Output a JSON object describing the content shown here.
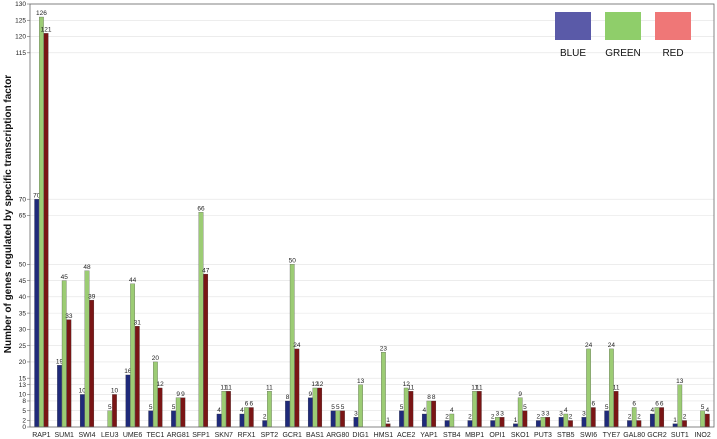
{
  "chart_data": {
    "type": "bar",
    "ylabel": "Number of genes regulated by specific transcription factor",
    "xlabel": "",
    "ylim": [
      0,
      130
    ],
    "yticks": [
      0,
      2,
      5,
      8,
      10,
      13,
      15,
      20,
      25,
      30,
      35,
      40,
      45,
      50,
      65,
      70,
      115,
      120,
      125,
      130
    ],
    "ytick_labels": [
      "0",
      "2",
      "5",
      "8",
      "10",
      "13",
      "15",
      "20",
      "25",
      "30",
      "35",
      "40",
      "45",
      "50",
      "65",
      "70",
      "115",
      "120",
      "125",
      "130"
    ],
    "grid": true,
    "legend_position": "top-right",
    "categories": [
      "RAP1",
      "SUM1",
      "SWI4",
      "LEU3",
      "UME6",
      "TEC1",
      "ARG81",
      "SFP1",
      "SKN7",
      "RFX1",
      "SPT2",
      "GCR1",
      "BAS1",
      "ARG80",
      "DIG1",
      "HMS1",
      "ACE2",
      "YAP1",
      "STB4",
      "MBP1",
      "OPI1",
      "SKO1",
      "PUT3",
      "STB5",
      "SWI6",
      "TYE7",
      "GAL80",
      "GCR2",
      "SUT1",
      "INO2"
    ],
    "series": [
      {
        "name": "BLUE",
        "color": "#1f2a7a",
        "values": [
          70,
          19,
          10,
          null,
          16,
          5,
          5,
          null,
          4,
          4,
          2,
          8,
          9,
          5,
          3,
          null,
          5,
          4,
          2,
          2,
          2,
          1,
          2,
          3,
          3,
          5,
          2,
          4,
          1,
          null
        ]
      },
      {
        "name": "GREEN",
        "color": "#9ccc74",
        "values": [
          126,
          45,
          48,
          5,
          44,
          20,
          9,
          66,
          11,
          6,
          11,
          50,
          12,
          5,
          13,
          23,
          12,
          8,
          4,
          11,
          3,
          9,
          3,
          4,
          24,
          24,
          6,
          6,
          13,
          5
        ]
      },
      {
        "name": "RED",
        "color": "#7a1515",
        "values": [
          121,
          33,
          39,
          10,
          31,
          12,
          9,
          47,
          11,
          6,
          null,
          24,
          12,
          5,
          null,
          1,
          11,
          8,
          null,
          11,
          3,
          5,
          3,
          2,
          6,
          11,
          2,
          6,
          2,
          4
        ]
      }
    ],
    "legend_colors": {
      "BLUE": "#5a5aa8",
      "GREEN": "#8fce6a",
      "RED": "#ef7777"
    }
  }
}
